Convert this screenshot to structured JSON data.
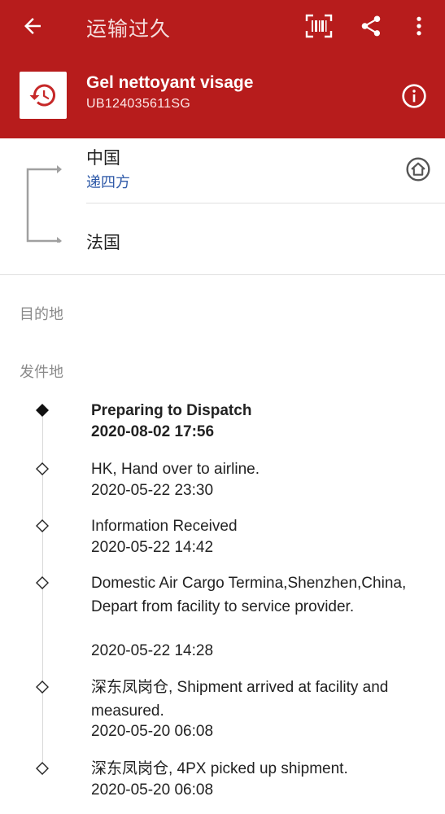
{
  "appbar": {
    "title": "运输过久",
    "icons": [
      "back-arrow-icon",
      "barcode-scan-icon",
      "share-icon",
      "more-vert-icon"
    ],
    "color": "#b71c1c"
  },
  "package": {
    "name": "Gel nettoyant visage",
    "tracking_no": "UB124035611SG",
    "icon": "history-icon"
  },
  "route": {
    "origin": "中国",
    "carrier": "递四方",
    "destination": "法国",
    "carrier_color": "#2f5aa8"
  },
  "sections": {
    "destination_label": "目的地",
    "origin_label": "发件地"
  },
  "events": [
    {
      "text": "Preparing to Dispatch",
      "time": "2020-08-02 17:56",
      "current": true
    },
    {
      "text": "HK, Hand over to airline.",
      "time": "2020-05-22 23:30",
      "current": false
    },
    {
      "text": "Information Received",
      "time": "2020-05-22 14:42",
      "current": false
    },
    {
      "text": "Domestic Air Cargo Termina,Shenzhen,China, Depart from facility to service provider.",
      "time": "2020-05-22 14:28",
      "current": false
    },
    {
      "text": "深东凤岗仓, Shipment arrived at facility and measured.",
      "time": "2020-05-20 06:08",
      "current": false
    },
    {
      "text": "深东凤岗仓, 4PX picked up shipment.",
      "time": "2020-05-20 06:08",
      "current": false
    }
  ]
}
